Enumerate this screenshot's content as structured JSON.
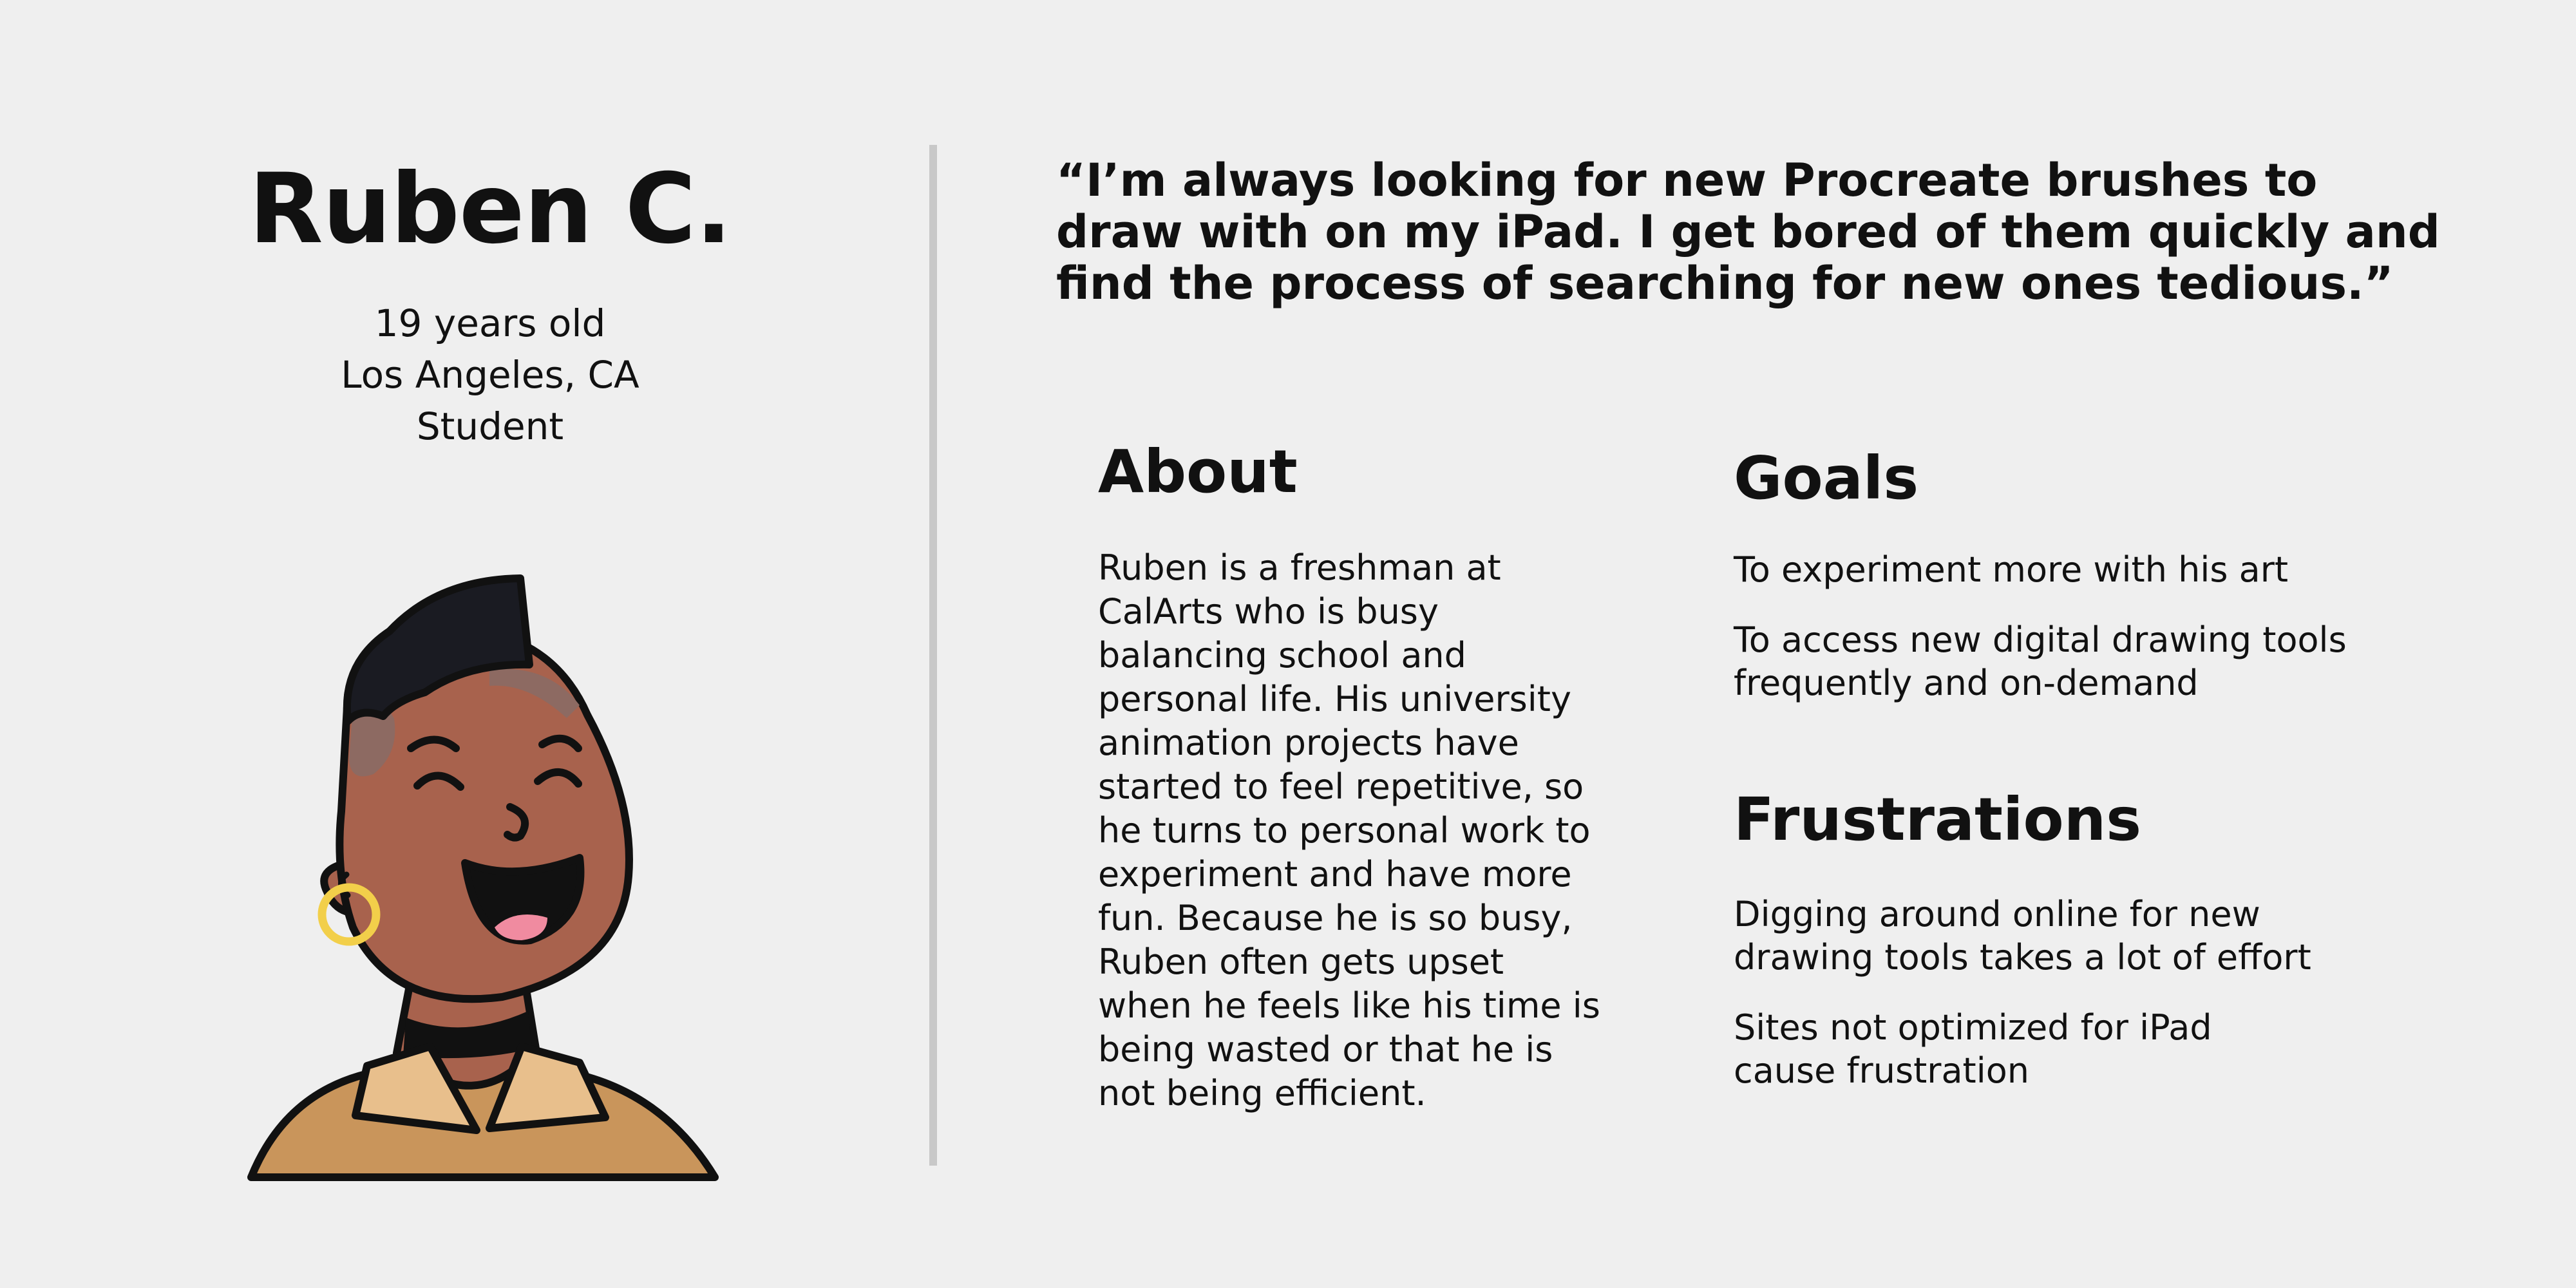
{
  "persona": {
    "name": "Ruben C.",
    "details": [
      "19 years old",
      "Los Angeles, CA",
      "Student"
    ]
  },
  "quote": {
    "lines": [
      "“I’m always looking for new Procreate brushes to",
      "draw with on my iPad. I get bored of them quickly and",
      "find the process of searching for new ones tedious.”"
    ]
  },
  "about": {
    "title": "About",
    "lines": [
      "Ruben is a freshman at",
      "CalArts who is busy",
      "balancing school and",
      "personal life. His university",
      "animation projects have",
      "started to feel repetitive, so",
      "he turns to personal work to",
      "experiment and have more",
      "fun. Because he is so busy,",
      "Ruben often gets upset",
      "when he feels like his time is",
      "being wasted or that he is",
      "not being efficient."
    ]
  },
  "goals": {
    "title": "Goals",
    "items": [
      {
        "lines": [
          "To experiment more with his art"
        ]
      },
      {
        "lines": [
          "To access new digital drawing tools",
          "frequently and on-demand"
        ]
      }
    ]
  },
  "frustrations": {
    "title": "Frustrations",
    "items": [
      {
        "lines": [
          "Digging around online for new",
          "drawing tools takes a lot of effort"
        ]
      },
      {
        "lines": [
          "Sites not optimized for iPad",
          "cause frustration"
        ]
      }
    ]
  },
  "colors": {
    "background": "#efefef",
    "divider": "#c8c8c8",
    "text": "#111111",
    "skin": "#a8624d",
    "hair": "#1a1b22",
    "shirt": "#c9955b",
    "collar": "#e8bf8c",
    "earring": "#f2cf4a",
    "tongue": "#f08ba0"
  },
  "icons": {
    "avatar": "persona-avatar-illustration"
  }
}
